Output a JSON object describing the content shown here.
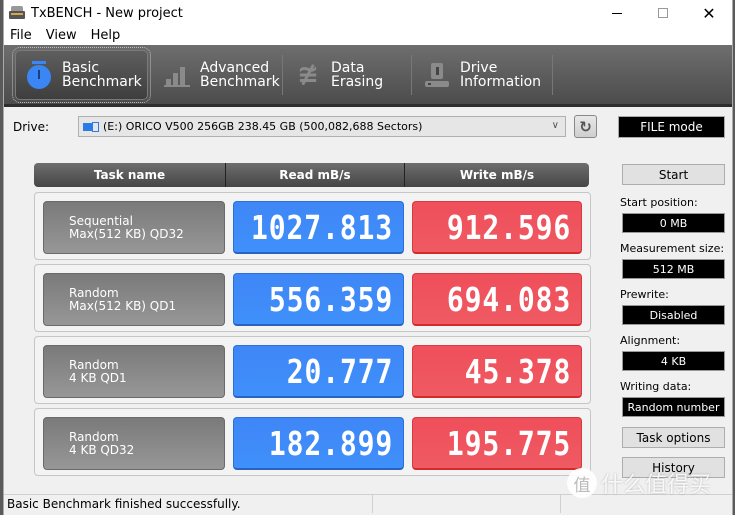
{
  "window": {
    "title": "TxBENCH - New project",
    "controls": {
      "minimize": "minimize",
      "maximize": "maximize",
      "close": "✕"
    }
  },
  "menu": [
    "File",
    "View",
    "Help"
  ],
  "toolbar": {
    "tabs": [
      {
        "label": "Basic\nBenchmark",
        "icon": "stopwatch-icon",
        "active": true
      },
      {
        "label": "Advanced\nBenchmark",
        "icon": "bar-chart-icon",
        "active": false
      },
      {
        "label": "Data Erasing",
        "icon": "eraser-icon",
        "active": false
      },
      {
        "label": "Drive\nInformation",
        "icon": "drive-icon",
        "active": false
      }
    ]
  },
  "drive": {
    "label": "Drive:",
    "selected": "(E:) ORICO V500 256GB  238.45 GB (500,082,688 Sectors)",
    "mode": "FILE mode"
  },
  "results": {
    "headers": [
      "Task name",
      "Read mB/s",
      "Write mB/s"
    ],
    "rows": [
      {
        "task_line1": "Sequential",
        "task_line2": "Max(512 KB) QD32",
        "read": "1027.813",
        "write": "912.596"
      },
      {
        "task_line1": "Random",
        "task_line2": "Max(512 KB) QD1",
        "read": "556.359",
        "write": "694.083"
      },
      {
        "task_line1": "Random",
        "task_line2": "4 KB QD1",
        "read": "20.777",
        "write": "45.378"
      },
      {
        "task_line1": "Random",
        "task_line2": "4 KB QD32",
        "read": "182.899",
        "write": "195.775"
      }
    ],
    "colors": {
      "read": "#3f8cf8",
      "write": "#ef535d",
      "task": "#8a8a8a"
    }
  },
  "panel": {
    "start_button": "Start",
    "start_position_label": "Start position:",
    "start_position": "0 MB",
    "measurement_size_label": "Measurement size:",
    "measurement_size": "512 MB",
    "prewrite_label": "Prewrite:",
    "prewrite": "Disabled",
    "alignment_label": "Alignment:",
    "alignment": "4 KB",
    "writing_data_label": "Writing data:",
    "writing_data": "Random number",
    "task_options_button": "Task options",
    "history_button": "History"
  },
  "status": {
    "message": "Basic Benchmark finished successfully."
  },
  "watermark": {
    "badge": "值",
    "text": "什么值得买"
  }
}
